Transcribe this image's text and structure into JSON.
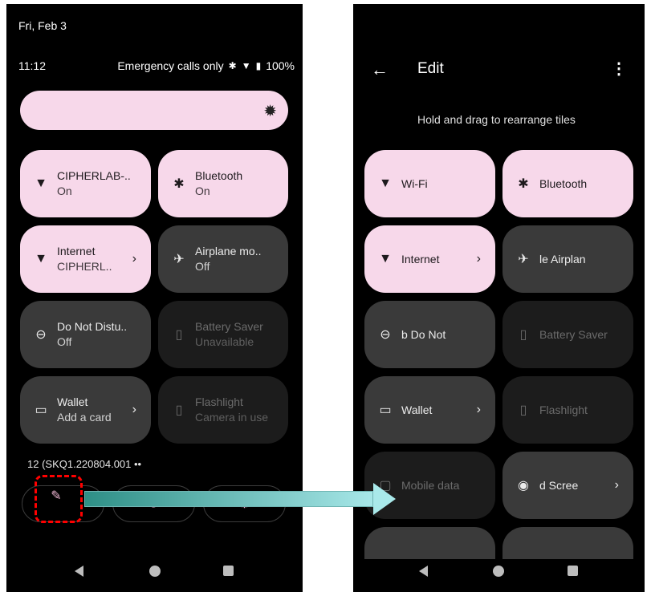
{
  "left": {
    "date": "Fri, Feb 3",
    "time": "11:12",
    "status": {
      "text": "Emergency calls only",
      "battery": "100%"
    },
    "tiles": [
      {
        "icon": "▼",
        "title": "CIPHERLAB-..",
        "sub": "On",
        "chev": ""
      },
      {
        "icon": "✱",
        "title": "Bluetooth",
        "sub": "On",
        "chev": ""
      },
      {
        "icon": "▼",
        "title": "Internet",
        "sub": "CIPHERL..",
        "chev": "›"
      },
      {
        "icon": "✈",
        "title": "Airplane mo..",
        "sub": "Off",
        "chev": ""
      },
      {
        "icon": "⊖",
        "title": "Do Not Distu..",
        "sub": "Off",
        "chev": ""
      },
      {
        "icon": "▯",
        "title": "Battery Saver",
        "sub": "Unavailable",
        "chev": ""
      },
      {
        "icon": "▭",
        "title": "Wallet",
        "sub": "Add a card",
        "chev": "›"
      },
      {
        "icon": "▯",
        "title": "Flashlight",
        "sub": "Camera in use",
        "chev": ""
      }
    ],
    "build": "12 (SKQ1.220804.001 ••"
  },
  "right": {
    "title": "Edit",
    "more": "⋮",
    "hint": "Hold and drag to rearrange tiles",
    "tiles": [
      {
        "icon": "▼",
        "title": "Wi-Fi",
        "chev": ""
      },
      {
        "icon": "✱",
        "title": "Bluetooth",
        "chev": ""
      },
      {
        "icon": "▼",
        "title": "Internet",
        "chev": "›"
      },
      {
        "icon": "✈",
        "title": "le     Airplan",
        "chev": ""
      },
      {
        "icon": "⊖",
        "title": "b      Do Not",
        "chev": ""
      },
      {
        "icon": "▯",
        "title": "Battery Saver",
        "chev": ""
      },
      {
        "icon": "▭",
        "title": "Wallet",
        "chev": "›"
      },
      {
        "icon": "▯",
        "title": "Flashlight",
        "chev": ""
      },
      {
        "icon": "▢",
        "title": "Mobile data",
        "chev": ""
      },
      {
        "icon": "◉",
        "title": "d      Scree",
        "chev": "›"
      }
    ]
  },
  "colors": {
    "tile_on": "#f7d8ea",
    "tile_off": "#3a3a3a",
    "highlight": "#ff0000",
    "arrow": "#2e8f86"
  }
}
